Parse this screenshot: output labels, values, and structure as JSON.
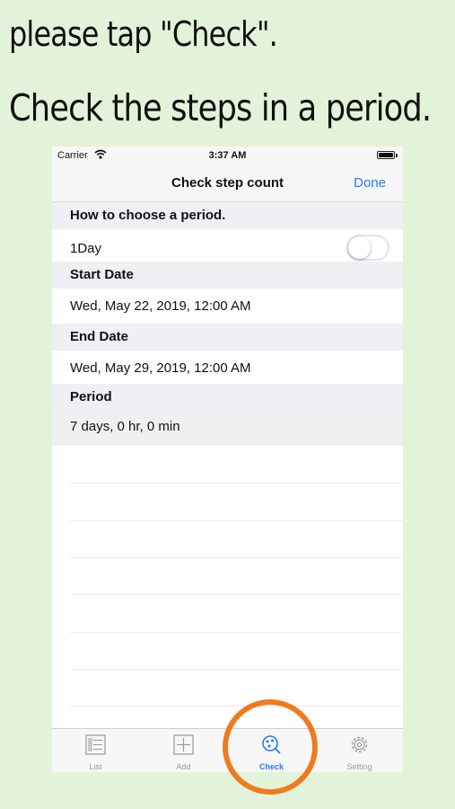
{
  "promo": {
    "line1": "please tap \"Check\".",
    "line2": "Check the steps in a period."
  },
  "status_bar": {
    "carrier": "Carrier",
    "time": "3:37 AM"
  },
  "nav": {
    "title": "Check step count",
    "done": "Done"
  },
  "form": {
    "choose_header": "How to choose a period.",
    "one_day_label": "1Day",
    "one_day_enabled": false,
    "start_header": "Start Date",
    "start_value": "Wed, May 22, 2019, 12:00 AM",
    "end_header": "End Date",
    "end_value": "Wed, May 29, 2019, 12:00 AM",
    "period_header": "Period",
    "period_value": "7 days, 0 hr, 0 min"
  },
  "tabs": [
    {
      "label": "List",
      "icon": "list-icon",
      "active": false
    },
    {
      "label": "Add",
      "icon": "add-icon",
      "active": false
    },
    {
      "label": "Check",
      "icon": "check-search-icon",
      "active": true
    },
    {
      "label": "Setting",
      "icon": "gear-icon",
      "active": false
    }
  ],
  "colors": {
    "background": "#e3f3d9",
    "accent": "#1f7cf5",
    "highlight_circle": "#f07b1e"
  }
}
